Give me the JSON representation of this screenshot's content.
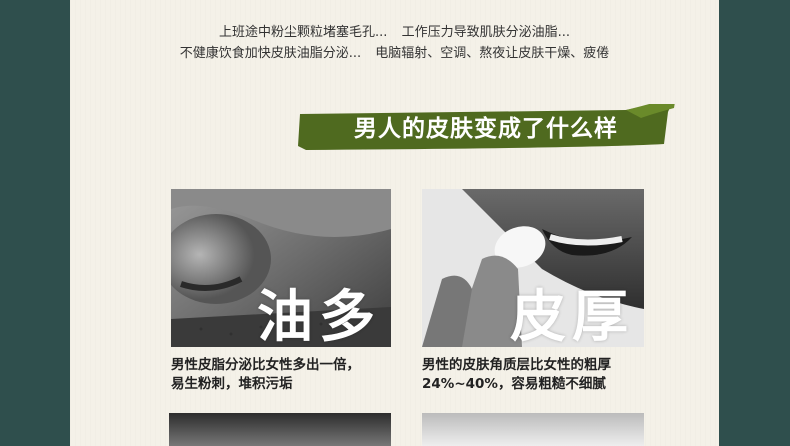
{
  "intro": {
    "line1": [
      "上班途中粉尘颗粒堵塞毛孔...",
      "工作压力导致肌肤分泌油脂..."
    ],
    "line2": [
      "不健康饮食加快皮肤油脂分泌...",
      "电脑辐射、空调、熬夜让皮肤干燥、疲倦"
    ]
  },
  "banner": {
    "title": "男人的皮肤变成了什么样",
    "color": "#4f6a1f"
  },
  "cards": [
    {
      "word": "油多",
      "desc": "男性皮脂分泌比女性多出一倍，\n易生粉刺，堆积污垢"
    },
    {
      "word": "皮厚",
      "desc": "男性的皮肤角质层比女性的粗厚\n24%~40%，容易粗糙不细腻"
    }
  ]
}
